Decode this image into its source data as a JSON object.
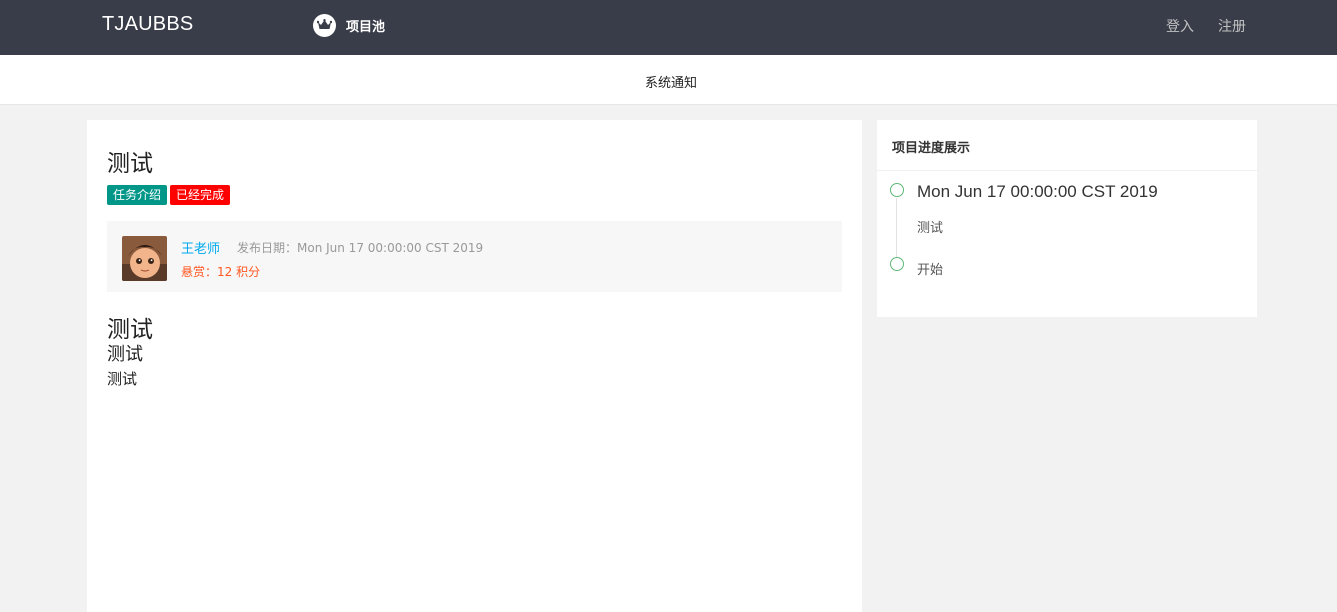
{
  "header": {
    "logo": "TJAUBBS",
    "nav_pool": {
      "icon": "crown-icon",
      "label": "项目池"
    },
    "login": "登入",
    "register": "注册"
  },
  "notice": {
    "label": "系统通知"
  },
  "post": {
    "title": "测试",
    "badges": [
      {
        "label": "任务介绍",
        "color": "#009688"
      },
      {
        "label": "已经完成",
        "color": "#ff0000"
      }
    ],
    "author": "王老师",
    "publish_date": "发布日期：Mon Jun 17 00:00:00 CST 2019",
    "reward": "悬赏：12 积分",
    "content": {
      "h1": "测试",
      "h2": "测试",
      "p": "测试"
    }
  },
  "progress": {
    "title": "项目进度展示",
    "items": [
      {
        "date": "Mon Jun 17 00:00:00 CST 2019",
        "text": "测试"
      },
      {
        "text": "开始"
      }
    ]
  },
  "colors": {
    "topbar": "#393d49",
    "accent_teal": "#009688",
    "accent_red": "#ff0000",
    "author_link": "#01aaed",
    "reward": "#ff5722",
    "timeline_dot": "#5fb878"
  }
}
